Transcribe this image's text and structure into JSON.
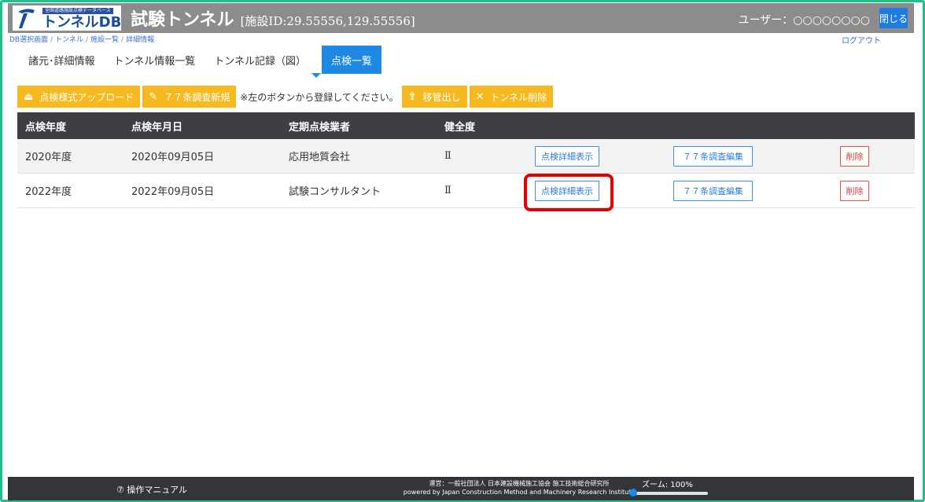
{
  "header": {
    "logo_sub": "全国道路施設点検データベース",
    "logo_text": "トンネルDB",
    "title": "試験トンネル",
    "facility": "[施設ID:29.55556,129.55556]",
    "user": "ユーザー：○○○○○○○○",
    "close_label": "閉じる"
  },
  "breadcrumb": {
    "items": [
      "DB選択画面",
      "トンネル",
      "施設一覧",
      "詳細情報"
    ],
    "separator": "/"
  },
  "logout_label": "ログアウト",
  "tabs": [
    {
      "label": "諸元･詳細情報"
    },
    {
      "label": "トンネル情報一覧"
    },
    {
      "label": "トンネル記録（図）"
    },
    {
      "label": "点検一覧",
      "active": true
    }
  ],
  "toolbar": {
    "upload_label": "点検様式アップロード",
    "new77_label": "７７条調査新規",
    "note": "※左のボタンから登録してください。",
    "transfer_label": "移管出し",
    "delete_tunnel_label": "トンネル削除"
  },
  "table": {
    "columns": [
      "点検年度",
      "点検年月日",
      "定期点検業者",
      "健全度"
    ],
    "rows": [
      {
        "year": "2020年度",
        "date": "2020年09月05日",
        "company": "応用地質会社",
        "grade": "Ⅱ"
      },
      {
        "year": "2022年度",
        "date": "2022年09月05日",
        "company": "試験コンサルタント",
        "grade": "Ⅱ"
      }
    ],
    "detail_label": "点検詳細表示",
    "edit77_label": "７７条調査編集",
    "delete_label": "削除"
  },
  "footer": {
    "manual": "⑦ 操作マニュアル",
    "credit_line1": "運営：一般社団法人 日本建設機械施工協会 施工技術総合研究所",
    "credit_line2": "powered by Japan Construction Method and Machinery Research Institute",
    "zoom_label": "ズーム: 100%",
    "zoom_value": 1.0
  },
  "colors": {
    "frame": "#1fc08a",
    "header": "#8c8c8c",
    "accent": "#1e88e5",
    "toolbar": "#f6b91f",
    "highlight": "#e00000"
  }
}
